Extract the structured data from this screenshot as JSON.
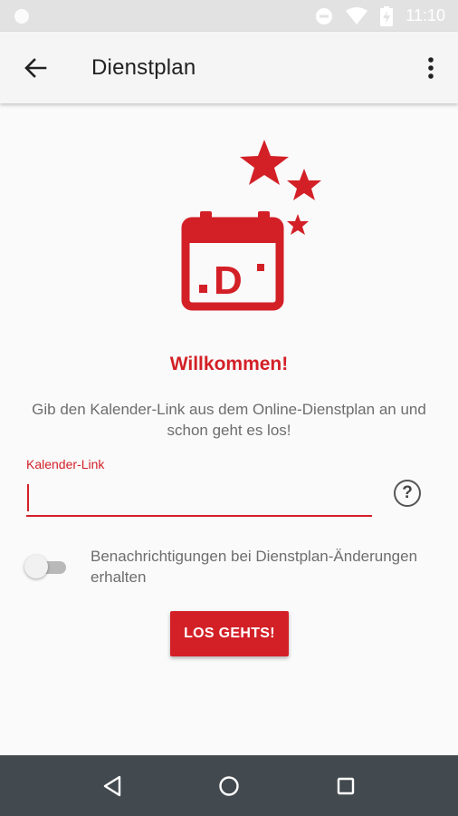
{
  "status_bar": {
    "time": "11:10",
    "icons": [
      "notification-dot-icon",
      "do-not-disturb-icon",
      "wifi-icon",
      "battery-charging-icon"
    ]
  },
  "app_bar": {
    "title": "Dienstplan",
    "back_icon": "arrow-back-icon",
    "menu_icon": "more-vert-icon"
  },
  "logo": {
    "calendar_text": ".D·",
    "icons": [
      "calendar-icon",
      "star-icon"
    ]
  },
  "content": {
    "welcome": "Willkommen!",
    "description": "Gib den Kalender-Link aus dem Online-Dienstplan an und schon geht es los!",
    "field_label": "Kalender-Link",
    "field_value": "",
    "help_icon": "?",
    "toggle_label": "Benachrichtigungen bei Dienstplan-Änderungen erhalten",
    "toggle_on": false,
    "button_label": "LOS GEHTS!"
  },
  "nav_bar": {
    "icons": [
      "back-triangle-icon",
      "home-circle-icon",
      "recents-square-icon"
    ]
  },
  "colors": {
    "accent": "#d32027",
    "status_bar": "#e2e2e2",
    "nav_bar": "#434a4f",
    "background": "#fafafa"
  }
}
